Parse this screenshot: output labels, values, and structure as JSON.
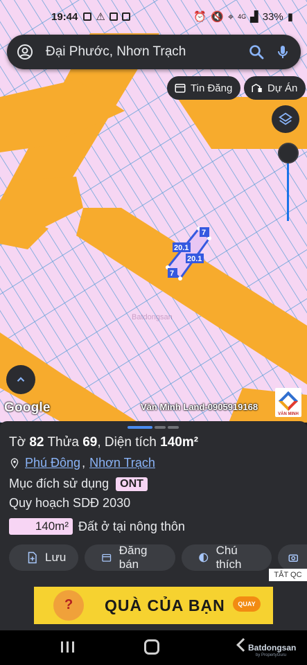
{
  "status_bar": {
    "time": "19:44",
    "battery": "33%",
    "network": "4G"
  },
  "search": {
    "text": "Đại Phước, Nhơn Trạch"
  },
  "chips": {
    "listings": "Tin Đăng",
    "projects": "Dự Án"
  },
  "map": {
    "colors": {
      "parcel": "#f6d6f3",
      "road": "#f7ab2d",
      "grid_line": "#5c9fd6",
      "selection": "#3559e0"
    },
    "dims": [
      "20.1",
      "7",
      "20.1",
      "7"
    ],
    "faint_watermark": "Batdongsan",
    "google_label": "Google",
    "watermark": "Văn Minh Land-0905919168",
    "logo_text": "VĂN MINH"
  },
  "sheet": {
    "parcel": {
      "to_label": "Tờ",
      "to": "82",
      "thua_label": "Thửa",
      "thua": "69",
      "area_label": ", Diện tích",
      "area": "140m²"
    },
    "location": {
      "ward": "Phú Đông",
      "district": "Nhơn Trạch"
    },
    "purpose": {
      "label": "Mục đích sử dụng",
      "code": "ONT"
    },
    "plan": "Quy hoạch SDĐ 2030",
    "land_use": {
      "area": "140m²",
      "description": "Đất ở tại nông thôn"
    },
    "actions": {
      "save": "Lưu",
      "post": "Đăng bán",
      "legend": "Chú thích"
    },
    "tat_qc": "TẮT QC",
    "banner": {
      "text": "QUÀ CỦA BẠN",
      "button": "QUAY"
    }
  },
  "navbar": {
    "brand": "Batdongsan",
    "brand_sub": "by PropertyGuru"
  }
}
